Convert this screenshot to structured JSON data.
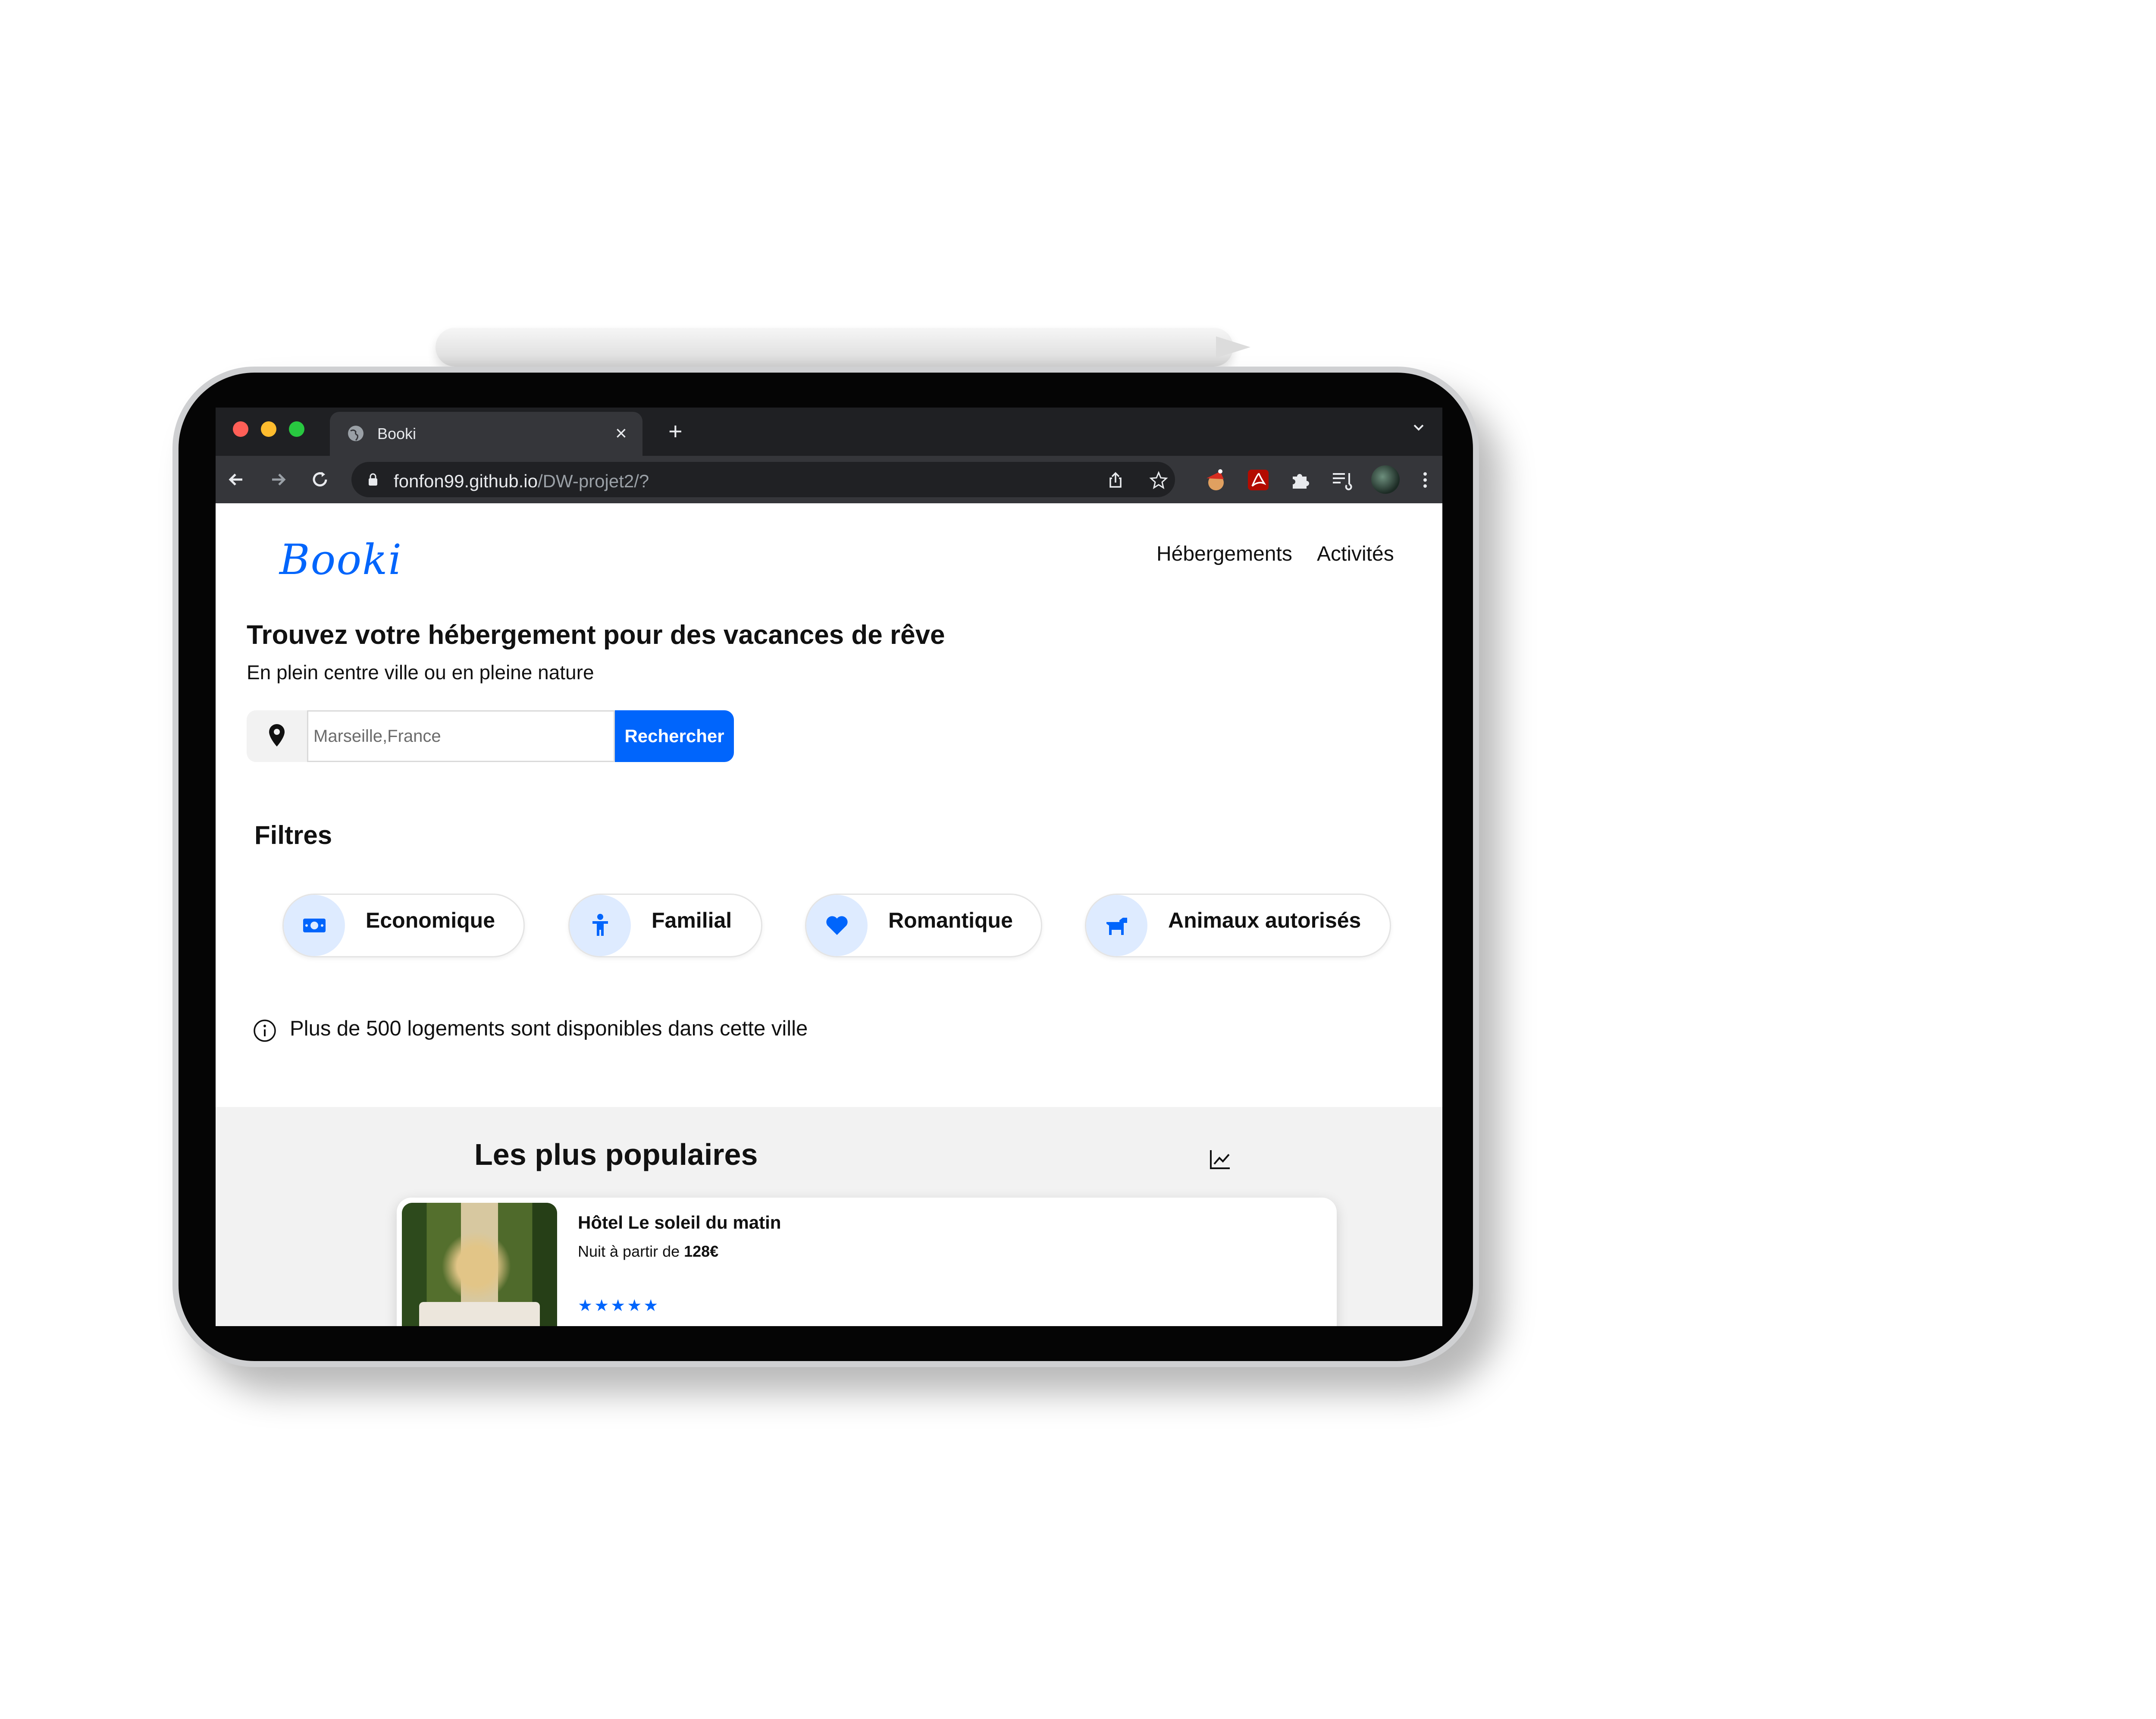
{
  "browser": {
    "tab_title": "Booki",
    "url_host": "fonfon99.github.io",
    "url_path": "/DW-projet2/?"
  },
  "header": {
    "logo": "Booki",
    "nav": [
      "Hébergements",
      "Activités"
    ]
  },
  "hero": {
    "title": "Trouvez votre hébergement pour des vacances de rêve",
    "subtitle": "En plein centre ville ou en pleine nature",
    "search_placeholder": "Marseille,France",
    "search_button": "Rechercher"
  },
  "filters": {
    "title": "Filtres",
    "items": [
      {
        "label": "Economique",
        "icon": "money-icon"
      },
      {
        "label": "Familial",
        "icon": "child-icon"
      },
      {
        "label": "Romantique",
        "icon": "heart-icon"
      },
      {
        "label": "Animaux autorisés",
        "icon": "dog-icon"
      }
    ]
  },
  "info": {
    "text": "Plus de 500 logements sont disponibles dans cette ville"
  },
  "popular": {
    "title": "Les plus populaires",
    "card": {
      "title": "Hôtel Le soleil du matin",
      "price_prefix": "Nuit à partir de ",
      "price": "128€",
      "rating": 5,
      "stars": "★★★★★"
    }
  },
  "colors": {
    "accent": "#0065fc",
    "chip_icon_bg": "#deebff",
    "popular_bg": "#f2f2f2"
  }
}
